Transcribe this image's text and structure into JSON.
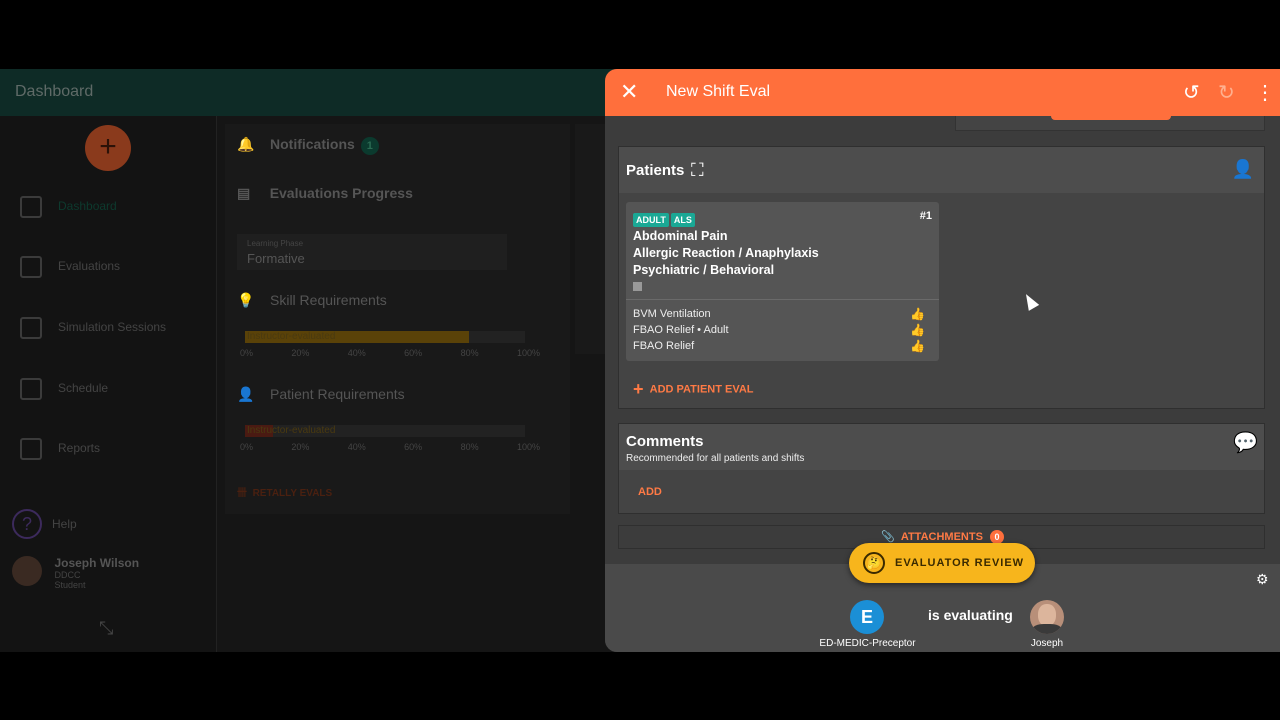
{
  "dashboard": {
    "title": "Dashboard",
    "nav": [
      {
        "label": "Dashboard",
        "icon": "dashboard-icon"
      },
      {
        "label": "Evaluations",
        "icon": "checklist-icon"
      },
      {
        "label": "Simulation Sessions",
        "icon": "simulation-icon"
      },
      {
        "label": "Schedule",
        "icon": "calendar-icon"
      },
      {
        "label": "Reports",
        "icon": "reports-icon"
      }
    ],
    "help_label": "Help",
    "user": {
      "name": "Joseph Wilson",
      "org": "DDCC",
      "role": "Student"
    },
    "notifications": {
      "label": "Notifications",
      "count": "1"
    },
    "evaluations_progress": "Evaluations Progress",
    "learning_phase": {
      "label": "Learning Phase",
      "value": "Formative"
    },
    "skill_requirements": "Skill Requirements",
    "skill_bar_label": "Instructor-evaluated",
    "patient_requirements": "Patient Requirements",
    "patient_bar_label": "Instructor-evaluated",
    "ticks": [
      "0%",
      "20%",
      "40%",
      "60%",
      "80%",
      "100%"
    ],
    "retally": "RETALLY EVALS",
    "skill_progress": 0.8,
    "patient_progress": 0.1
  },
  "drawer": {
    "title": "New Shift Eval",
    "patients": {
      "heading": "Patients",
      "card": {
        "tags": [
          "ADULT",
          "ALS"
        ],
        "number": "#1",
        "conditions": [
          "Abdominal Pain",
          "Allergic Reaction / Anaphylaxis",
          "Psychiatric / Behavioral"
        ],
        "skills": [
          "BVM Ventilation",
          "FBAO Relief • Adult",
          "FBAO Relief"
        ]
      },
      "add_label": "ADD PATIENT EVAL"
    },
    "comments": {
      "heading": "Comments",
      "subtitle": "Recommended for all patients and shifts",
      "add_label": "ADD"
    },
    "attachments": {
      "label": "ATTACHMENTS",
      "count": "0"
    },
    "review_label": "EVALUATOR REVIEW",
    "evaluator": {
      "initial": "E",
      "name": "ED-MEDIC-Preceptor"
    },
    "is_evaluating": "is evaluating",
    "student": {
      "name": "Joseph"
    }
  },
  "colors": {
    "accent": "#ff6f3c",
    "teal": "#1aa895",
    "review": "#f7b51c",
    "evaluator": "#1b8fd6"
  }
}
